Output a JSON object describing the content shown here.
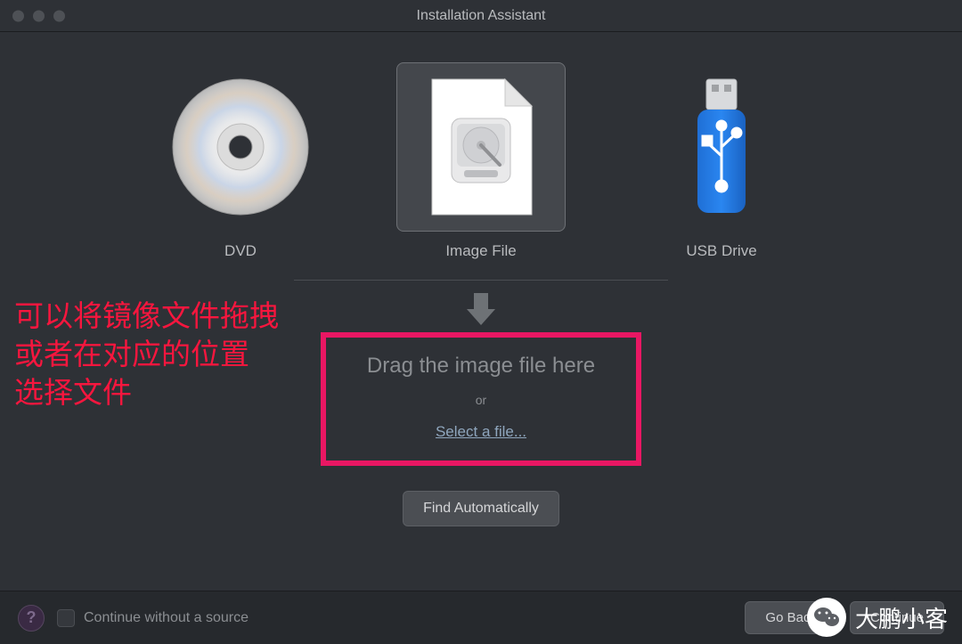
{
  "window": {
    "title": "Installation Assistant"
  },
  "sources": {
    "dvd": {
      "label": "DVD"
    },
    "image": {
      "label": "Image File"
    },
    "usb": {
      "label": "USB Drive"
    }
  },
  "dropzone": {
    "title": "Drag the image file here",
    "or": "or",
    "select": "Select a file..."
  },
  "find_auto": "Find Automatically",
  "footer": {
    "continue_label": "Continue without a source",
    "go_back": "Go Back",
    "continue": "Continue"
  },
  "annotation": {
    "line1": "可以将镜像文件拖拽",
    "line2": "或者在对应的位置",
    "line3": "选择文件"
  },
  "watermark": {
    "text": "大鹏小客"
  }
}
